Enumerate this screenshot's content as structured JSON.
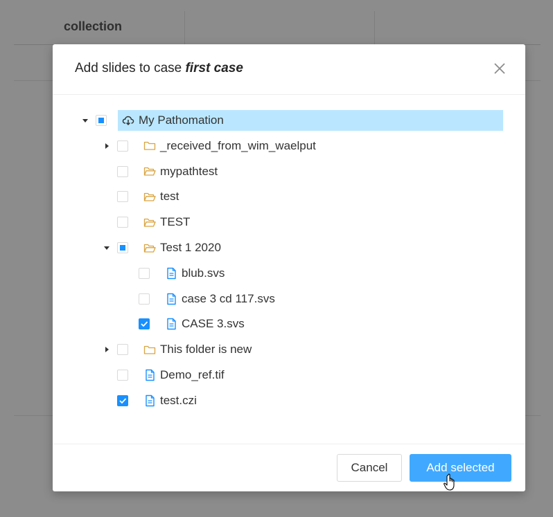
{
  "background": {
    "column_header": "collection"
  },
  "modal": {
    "title_prefix": "Add slides to case ",
    "title_case": "first case",
    "close_icon": "close-icon",
    "footer": {
      "cancel_label": "Cancel",
      "add_selected_label": "Add selected"
    }
  },
  "tree": {
    "root": {
      "label": "My Pathomation",
      "icon": "cloud-icon",
      "check": "indeterminate",
      "expanded": true,
      "selected": true
    },
    "items": [
      {
        "label": "_received_from_wim_waelput",
        "icon": "folder-icon",
        "check": "unchecked",
        "expandable": true,
        "expanded": false
      },
      {
        "label": "mypathtest",
        "icon": "folder-open-icon",
        "check": "unchecked"
      },
      {
        "label": "test",
        "icon": "folder-open-icon",
        "check": "unchecked"
      },
      {
        "label": "TEST",
        "icon": "folder-open-icon",
        "check": "unchecked"
      },
      {
        "label": "Test 1 2020",
        "icon": "folder-open-icon",
        "check": "indeterminate",
        "expandable": true,
        "expanded": true,
        "children": [
          {
            "label": "blub.svs",
            "icon": "file-icon",
            "check": "unchecked"
          },
          {
            "label": "case 3 cd 117.svs",
            "icon": "file-icon",
            "check": "unchecked"
          },
          {
            "label": "CASE 3.svs",
            "icon": "file-icon",
            "check": "checked"
          }
        ]
      },
      {
        "label": "This folder is new",
        "icon": "folder-icon",
        "check": "unchecked",
        "expandable": true,
        "expanded": false
      },
      {
        "label": "Demo_ref.tif",
        "icon": "file-icon",
        "check": "unchecked"
      },
      {
        "label": "test.czi",
        "icon": "file-icon",
        "check": "checked"
      }
    ]
  },
  "colors": {
    "primary": "#1890ff",
    "primary_button": "#40a9ff",
    "selected_row": "#bae7ff",
    "folder": "#d9a441",
    "file": "#1890ff"
  }
}
